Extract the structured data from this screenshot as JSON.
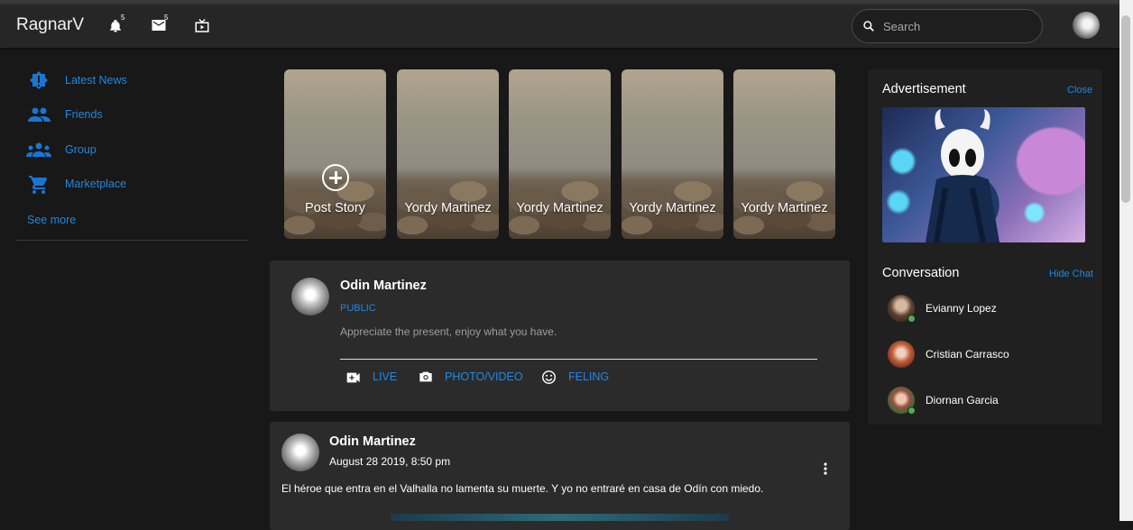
{
  "app": {
    "brand": "RagnarV"
  },
  "topbar": {
    "notifications_count": "5",
    "messages_count": "5",
    "search_placeholder": "Search"
  },
  "sidebar": {
    "items": [
      {
        "label": "Latest News",
        "icon": "alert-circle-icon"
      },
      {
        "label": "Friends",
        "icon": "people-icon"
      },
      {
        "label": "Group",
        "icon": "group-icon"
      },
      {
        "label": "Marketplace",
        "icon": "cart-icon"
      }
    ],
    "see_more": "See more"
  },
  "stories": [
    {
      "label": "Post Story"
    },
    {
      "label": "Yordy Martinez"
    },
    {
      "label": "Yordy Martinez"
    },
    {
      "label": "Yordy Martinez"
    },
    {
      "label": "Yordy Martinez"
    }
  ],
  "composer": {
    "user": "Odin Martinez",
    "visibility": "PUBLIC",
    "placeholder": "Appreciate the present, enjoy what you have.",
    "actions": [
      {
        "label": "LIVE",
        "icon": "video-camera-icon"
      },
      {
        "label": "PHOTO/VIDEO",
        "icon": "camera-icon"
      },
      {
        "label": "FELING",
        "icon": "smiley-icon"
      }
    ]
  },
  "post": {
    "user": "Odin Martinez",
    "date": "August 28 2019, 8:50 pm",
    "text": "El héroe que entra en el Valhalla no lamenta su muerte. Y yo no entraré en casa de Odín con miedo."
  },
  "advertisement": {
    "title": "Advertisement",
    "close": "Close"
  },
  "conversation": {
    "title": "Conversation",
    "hide": "Hide Chat",
    "contacts": [
      {
        "name": "Evianny Lopez",
        "online": true
      },
      {
        "name": "Cristian Carrasco",
        "online": false
      },
      {
        "name": "Diornan Garcia",
        "online": true
      }
    ]
  },
  "colors": {
    "accent": "#1e88e5",
    "background": "#181818",
    "card": "#2b2b2b",
    "online": "#4caf50"
  }
}
